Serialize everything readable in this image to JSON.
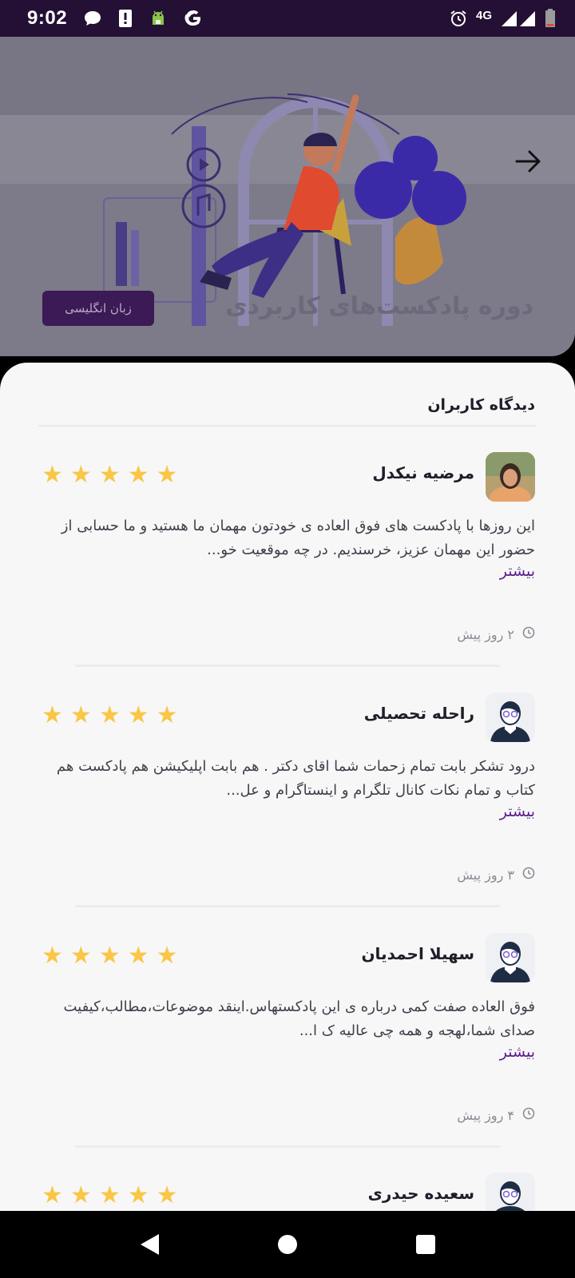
{
  "status_bar": {
    "time": "9:02",
    "network": "4G",
    "icons": [
      "message-bubble-icon",
      "alert-icon",
      "android-debug-icon",
      "google-icon",
      "alarm-icon",
      "signal-icon",
      "battery-icon"
    ]
  },
  "hero": {
    "title": "دوره پادکست‌های کاربردی",
    "language_chip": "زبان انگلیسی",
    "back_icon": "arrow-right-icon"
  },
  "reviews_section": {
    "heading": "دیدگاه کاربران",
    "star_color": "#f9c646",
    "accent_color": "#5a1d8a",
    "items": [
      {
        "name": "مرضیه نیکدل",
        "rating": 5,
        "text": "این روزها با پادکست های فوق العاده ی خودتون مهمان ما هستید و ما حسابی از حضور این مهمان عزیز، خرسندیم. در چه موقعیت خو...",
        "more": "بیشتر",
        "time": "۲ روز پیش",
        "avatar": "user-photo"
      },
      {
        "name": "راحله تحصیلی",
        "rating": 5,
        "text": "درود تشکر بابت تمام زحمات شما اقای دکتر . هم بابت اپلیکیشن هم پادکست هم کتاب و تمام نکات کانال تلگرام و اینستاگرام و عل...",
        "more": "بیشتر",
        "time": "۳ روز پیش",
        "avatar": "default-avatar"
      },
      {
        "name": "سهیلا احمدیان",
        "rating": 5,
        "text": "فوق العاده صفت کمی درباره ی این پادکستهاس.اینقد موضوعات،مطالب،کیفیت صدای شما،لهجه و همه چی عالیه ک ا...",
        "more": "بیشتر",
        "time": "۴ روز پیش",
        "avatar": "default-avatar"
      },
      {
        "name": "سعیده حیدری",
        "rating": 5,
        "avatar": "default-avatar"
      }
    ]
  },
  "nav_bar": {
    "buttons": [
      "back-triangle-icon",
      "home-circle-icon",
      "recents-square-icon"
    ]
  }
}
